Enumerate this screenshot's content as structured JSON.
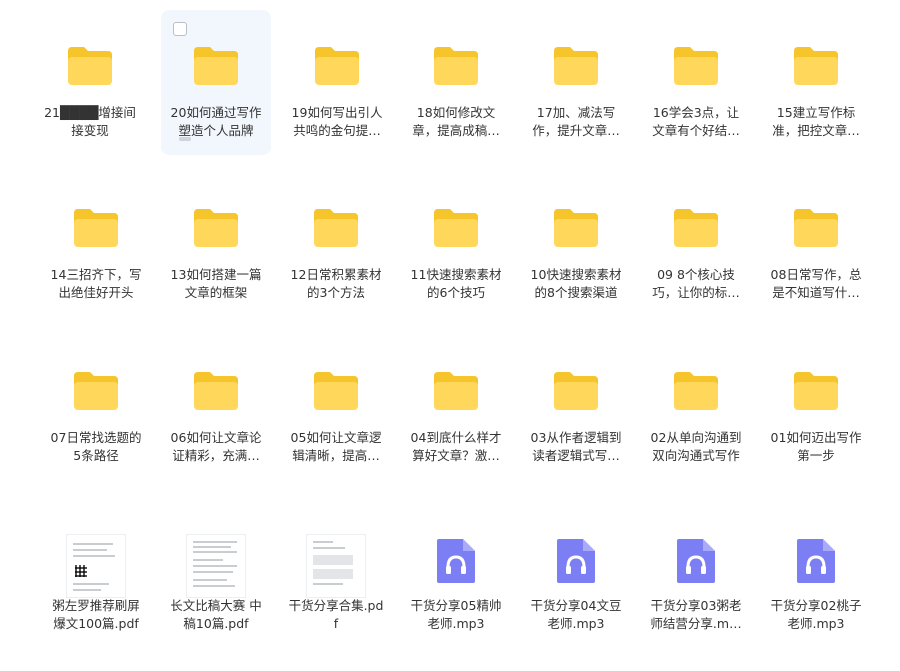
{
  "colors": {
    "folder_back": "#f5c52b",
    "folder_front": "#ffd75a",
    "audio_icon": "#7c7ff3",
    "selection_bg": "#f2f6fd"
  },
  "items": [
    {
      "label": "21████增接间接变现",
      "icon": "folder-icon"
    },
    {
      "label": "20如何通过写作塑造个人品牌",
      "icon": "folder-icon",
      "selected": true
    },
    {
      "label": "19如何写出引人共鸣的金句提…",
      "icon": "folder-icon"
    },
    {
      "label": "18如何修改文章，提高成稿…",
      "icon": "folder-icon"
    },
    {
      "label": "17加、减法写作，提升文章…",
      "icon": "folder-icon"
    },
    {
      "label": "16学会3点，让文章有个好结…",
      "icon": "folder-icon"
    },
    {
      "label": "15建立写作标准，把控文章…",
      "icon": "folder-icon"
    },
    {
      "label": "14三招齐下，写出绝佳好开头",
      "icon": "folder-icon"
    },
    {
      "label": "13如何搭建一篇文章的框架",
      "icon": "folder-icon"
    },
    {
      "label": "12日常积累素材的3个方法",
      "icon": "folder-icon"
    },
    {
      "label": "11快速搜索素材的6个技巧",
      "icon": "folder-icon"
    },
    {
      "label": "10快速搜索素材的8个搜索渠道",
      "icon": "folder-icon"
    },
    {
      "label": "09 8个核心技巧，让你的标…",
      "icon": "folder-icon"
    },
    {
      "label": "08日常写作，总是不知道写什…",
      "icon": "folder-icon"
    },
    {
      "label": "07日常找选题的5条路径",
      "icon": "folder-icon"
    },
    {
      "label": "06如何让文章论证精彩，充满…",
      "icon": "folder-icon"
    },
    {
      "label": "05如何让文章逻辑清晰，提高…",
      "icon": "folder-icon"
    },
    {
      "label": "04到底什么样才算好文章？激…",
      "icon": "folder-icon"
    },
    {
      "label": "03从作者逻辑到读者逻辑式写…",
      "icon": "folder-icon"
    },
    {
      "label": "02从单向沟通到双向沟通式写作",
      "icon": "folder-icon"
    },
    {
      "label": "01如何迈出写作第一步",
      "icon": "folder-icon"
    },
    {
      "label": "粥左罗推荐刷屏爆文100篇.pdf",
      "icon": "pdf-thumbnail-icon"
    },
    {
      "label": "长文比稿大赛 中稿10篇.pdf",
      "icon": "pdf-thumbnail-icon"
    },
    {
      "label": "干货分享合集.pdf",
      "icon": "pdf-thumbnail-icon"
    },
    {
      "label": "干货分享05精帅老师.mp3",
      "icon": "audio-file-icon"
    },
    {
      "label": "干货分享04文豆老师.mp3",
      "icon": "audio-file-icon"
    },
    {
      "label": "干货分享03粥老师结营分享.m…",
      "icon": "audio-file-icon"
    },
    {
      "label": "干货分享02桃子老师.mp3",
      "icon": "audio-file-icon"
    }
  ]
}
